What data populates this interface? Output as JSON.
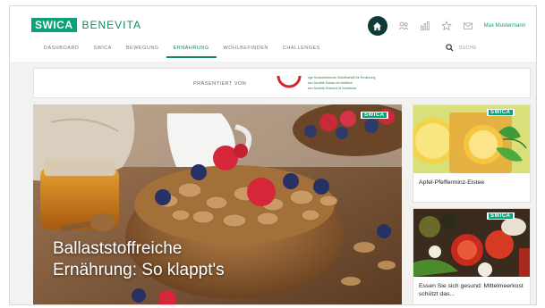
{
  "brand": {
    "logo": "SWICA",
    "name": "BENEVITA"
  },
  "header": {
    "user_name": "Max Mustermann"
  },
  "nav": {
    "items": [
      {
        "label": "DASHBOARD",
        "active": false
      },
      {
        "label": "SWICA",
        "active": false
      },
      {
        "label": "BEWEGUNG",
        "active": false
      },
      {
        "label": "ERNÄHRUNG",
        "active": true
      },
      {
        "label": "WOHLBEFINDEN",
        "active": false
      },
      {
        "label": "CHALLENGES",
        "active": false
      }
    ]
  },
  "search": {
    "label": "SUCHE"
  },
  "banner": {
    "label": "PRÄSENTIERT VON",
    "sponsor_lines": [
      "sge Schweizerische Gesellschaft für Ernährung",
      "ssn Société Suisse de Nutrition",
      "ssn Società Svizzera di Nutrizione"
    ]
  },
  "hero": {
    "tag": "SWICA",
    "title_line1": "Ballaststoffreiche",
    "title_line2": "Ernährung: So klappt's"
  },
  "cards": [
    {
      "tag": "SWICA",
      "title": "Apfel-Pfefferminz-Eistee"
    },
    {
      "tag": "SWICA",
      "title": "Essen Sie sich gesund: Mittelmeerkost schützt das..."
    }
  ],
  "colors": {
    "brand_green": "#0aa27a",
    "dark_teal": "#0e3b38",
    "sge_red": "#d6262b"
  },
  "icons": [
    "home-icon",
    "people-icon",
    "chart-icon",
    "star-icon",
    "mail-icon",
    "search-icon"
  ]
}
